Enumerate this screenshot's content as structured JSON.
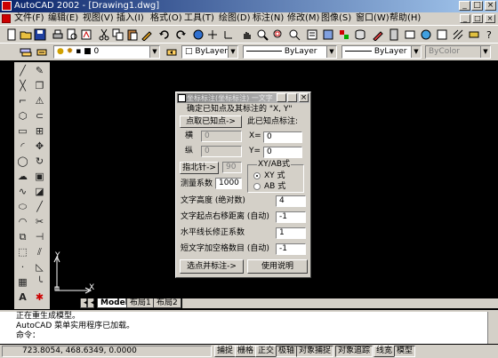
{
  "window": {
    "title": "AutoCAD 2002 - [Drawing1.dwg]",
    "controls": [
      "_",
      "□",
      "×"
    ]
  },
  "menu": {
    "items": [
      "文件(F)",
      "编辑(E)",
      "视图(V)",
      "插入(I)",
      "格式(O)",
      "工具(T)",
      "绘图(D)",
      "标注(N)",
      "修改(M)",
      "图像(S)",
      "窗口(W)",
      "帮助(H)"
    ],
    "mdi_controls": [
      "_",
      "□",
      "×"
    ]
  },
  "properties_toolbar": {
    "layer_value": "0",
    "color_value": "ByLayer",
    "linetype_value": "ByLayer",
    "lineweight_value": "ByLayer",
    "plotstyle_value": "ByColor"
  },
  "drawing_tabs": [
    "Model",
    "布局1",
    "布局2"
  ],
  "ucs": {
    "x_label": "X",
    "y_label": "Y"
  },
  "command_lines": [
    "正在重生成模型。",
    "AutoCAD 菜单实用程序已加载。",
    "命令："
  ],
  "status_bar": {
    "coordinates": "723.8054, 468.6349, 0.0000",
    "toggles": [
      "捕捉",
      "栅格",
      "正交",
      "极轴",
      "对象捕捉",
      "对象追踪",
      "线宽",
      "模型"
    ]
  },
  "dialog": {
    "title": "坐标标注(坐标标注) 一文字",
    "prompt": "确定已知点及其标注的 \"X, Y\"",
    "pick_button": "点取已知点->",
    "label_right": "此已知点标注:",
    "heng_label": "横",
    "heng_value": "0",
    "zong_label": "纵",
    "zong_value": "0",
    "x_label": "X=",
    "x_value": "0",
    "y_label": "Y=",
    "y_value": "0",
    "north_button": "指北针->",
    "north_value": "90",
    "scale_label": "测量系数",
    "scale_value": "1000",
    "mode_group": "XY/AB式",
    "mode_xy": "XY 式",
    "mode_ab": "AB 式",
    "text_height_label": "文字高度 (绝对数)",
    "text_height_value": "4",
    "text_offset_label": "文字起点右移距离 (自动)",
    "text_offset_value": "-1",
    "hline_label": "水平线长修正系数",
    "hline_value": "1",
    "spaces_label": "短文字加空格数目 (自动)",
    "spaces_value": "-1",
    "select_button": "选点并标注->",
    "help_button": "使用说明"
  }
}
